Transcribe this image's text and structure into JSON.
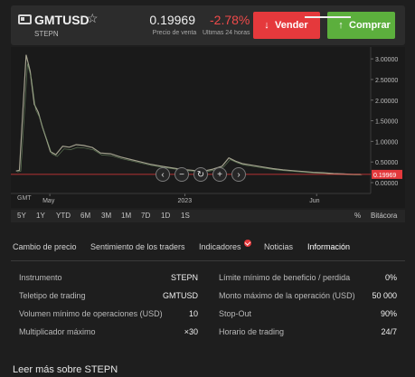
{
  "header": {
    "symbol": "GMTUSD",
    "name": "STEPN",
    "price": "0.19969",
    "price_label": "Precio de venta",
    "change": "-2.78%",
    "change_label": "Últimas 24 horas",
    "sell_label": "Vender",
    "buy_label": "Comprar",
    "colors": {
      "sell": "#e5393c",
      "buy": "#5caf3d",
      "negative": "#ef4a4a"
    }
  },
  "chart_data": {
    "type": "line",
    "title": "",
    "xlabel": "",
    "ylabel": "",
    "ylim": [
      0,
      3.2
    ],
    "y_ticks": [
      "3.00000",
      "2.50000",
      "2.00000",
      "1.50000",
      "1.00000",
      "0.50000",
      "0.00000"
    ],
    "x_ticks": [
      "May",
      "2023",
      "Jun"
    ],
    "timezone_label": "GMT",
    "current_price_label": "0.19969",
    "current_price": 0.19969,
    "series": [
      {
        "values": [
          [
            0.05,
            0.28
          ],
          [
            0.1,
            0.3
          ],
          [
            0.2,
            3.1
          ],
          [
            0.26,
            2.7
          ],
          [
            0.32,
            1.9
          ],
          [
            0.38,
            1.7
          ],
          [
            0.44,
            1.35
          ],
          [
            0.5,
            1.05
          ],
          [
            0.56,
            0.75
          ],
          [
            0.64,
            0.68
          ],
          [
            0.74,
            0.88
          ],
          [
            0.84,
            0.86
          ],
          [
            0.94,
            0.92
          ],
          [
            1.05,
            0.9
          ],
          [
            1.18,
            0.85
          ],
          [
            1.3,
            0.72
          ],
          [
            1.45,
            0.7
          ],
          [
            1.6,
            0.62
          ],
          [
            1.75,
            0.56
          ],
          [
            1.9,
            0.5
          ],
          [
            2.05,
            0.44
          ],
          [
            2.2,
            0.4
          ],
          [
            2.35,
            0.36
          ],
          [
            2.5,
            0.32
          ],
          [
            2.65,
            0.3
          ],
          [
            2.8,
            0.27
          ],
          [
            2.95,
            0.32
          ],
          [
            3.1,
            0.4
          ],
          [
            3.2,
            0.6
          ],
          [
            3.3,
            0.52
          ],
          [
            3.4,
            0.46
          ],
          [
            3.55,
            0.42
          ],
          [
            3.7,
            0.38
          ],
          [
            3.85,
            0.34
          ],
          [
            4.0,
            0.31
          ],
          [
            4.15,
            0.29
          ],
          [
            4.3,
            0.27
          ],
          [
            4.45,
            0.25
          ],
          [
            4.6,
            0.24
          ],
          [
            4.75,
            0.22
          ],
          [
            4.9,
            0.21
          ],
          [
            5.05,
            0.2
          ],
          [
            5.15,
            0.2
          ]
        ]
      }
    ]
  },
  "controls": {
    "prev": "‹",
    "zoom_out": "−",
    "reset": "↻",
    "zoom_in": "+",
    "next": "›"
  },
  "periods": [
    "5Y",
    "1Y",
    "YTD",
    "6M",
    "3M",
    "1M",
    "7D",
    "1D",
    "1S"
  ],
  "period_extra": {
    "percent": "%",
    "log": "Bitácora"
  },
  "tabs": [
    "Cambio de precio",
    "Sentimiento de los traders",
    "Indicadores",
    "Noticias",
    "Información"
  ],
  "active_tab": "Información",
  "info": {
    "left": [
      {
        "label": "Instrumento",
        "value": "STEPN"
      },
      {
        "label": "Teletipo de trading",
        "value": "GMTUSD"
      },
      {
        "label": "Volumen mínimo de operaciones (USD)",
        "value": "10"
      },
      {
        "label": "Multiplicador máximo",
        "value": "×30"
      }
    ],
    "right": [
      {
        "label": "Límite mínimo de beneficio / perdida",
        "value": "0%"
      },
      {
        "label": "Monto máximo de la operación (USD)",
        "value": "50 000"
      },
      {
        "label": "Stop-Out",
        "value": "90%"
      },
      {
        "label": "Horario de trading",
        "value": "24/7"
      }
    ]
  },
  "more_link": "Leer más sobre STEPN"
}
